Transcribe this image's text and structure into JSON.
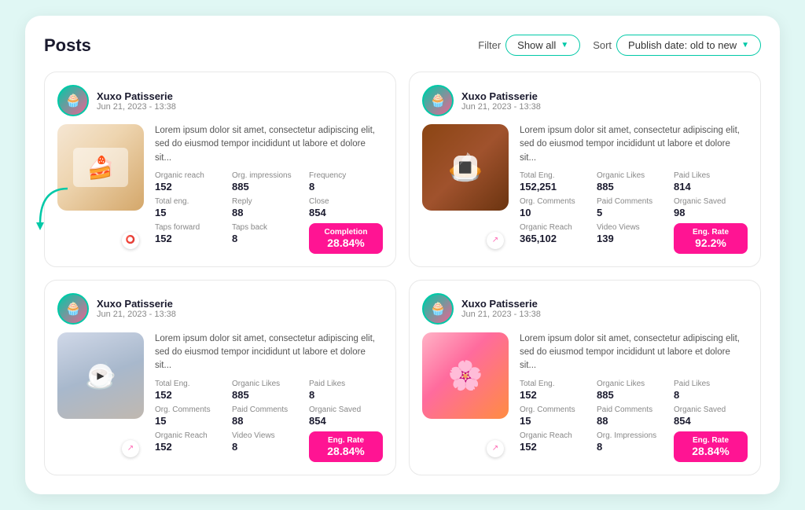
{
  "header": {
    "title": "Posts",
    "filter_label": "Filter",
    "filter_value": "Show all",
    "sort_label": "Sort",
    "sort_value": "Publish date: old to new"
  },
  "posts": [
    {
      "id": "post-1",
      "author": "Xuxo Patisserie",
      "date": "Jun 21, 2023 - 13:38",
      "description": "Lorem ipsum dolor sit amet, consectetur adipiscing elit, sed do eiusmod tempor incididunt ut labore et dolore sit...",
      "image_type": "cake",
      "image_icon": "story",
      "stats": [
        {
          "label": "Organic reach",
          "value": "152"
        },
        {
          "label": "Org. impressions",
          "value": "885"
        },
        {
          "label": "Frequency",
          "value": "8"
        },
        {
          "label": "Total eng.",
          "value": "15"
        },
        {
          "label": "Reply",
          "value": "88"
        },
        {
          "label": "Close",
          "value": "854"
        },
        {
          "label": "Taps forward",
          "value": "152"
        },
        {
          "label": "Taps back",
          "value": "8"
        }
      ],
      "highlight_label": "Completion",
      "highlight_value": "28.84%",
      "has_arrow": true
    },
    {
      "id": "post-2",
      "author": "Xuxo Patisserie",
      "date": "Jun 21, 2023 - 13:38",
      "description": "Lorem ipsum dolor sit amet, consectetur adipiscing elit, sed do eiusmod tempor incididunt ut labore et dolore sit...",
      "image_type": "pie",
      "image_icon": "reel",
      "stats": [
        {
          "label": "Total Eng.",
          "value": "152,251"
        },
        {
          "label": "Organic Likes",
          "value": "885"
        },
        {
          "label": "Paid Likes",
          "value": "814"
        },
        {
          "label": "Org. Comments",
          "value": "10"
        },
        {
          "label": "Paid Comments",
          "value": "5"
        },
        {
          "label": "Organic Saved",
          "value": "98"
        },
        {
          "label": "Organic Reach",
          "value": "365,102"
        },
        {
          "label": "Video Views",
          "value": "139"
        }
      ],
      "highlight_label": "Eng. Rate",
      "highlight_value": "92.2%",
      "has_arrow": false
    },
    {
      "id": "post-3",
      "author": "Xuxo Patisserie",
      "date": "Jun 21, 2023 - 13:38",
      "description": "Lorem ipsum dolor sit amet, consectetur adipiscing elit, sed do eiusmod tempor incididunt ut labore et dolore sit...",
      "image_type": "drink",
      "image_icon": "share",
      "stats": [
        {
          "label": "Total Eng.",
          "value": "152"
        },
        {
          "label": "Organic Likes",
          "value": "885"
        },
        {
          "label": "Paid Likes",
          "value": "8"
        },
        {
          "label": "Org. Comments",
          "value": "15"
        },
        {
          "label": "Paid Comments",
          "value": "88"
        },
        {
          "label": "Organic Saved",
          "value": "854"
        },
        {
          "label": "Organic Reach",
          "value": "152"
        },
        {
          "label": "Video Views",
          "value": "8"
        }
      ],
      "highlight_label": "Eng. Rate",
      "highlight_value": "28.84%",
      "has_arrow": false
    },
    {
      "id": "post-4",
      "author": "Xuxo Patisserie",
      "date": "Jun 21, 2023 - 13:38",
      "description": "Lorem ipsum dolor sit amet, consectetur adipiscing elit, sed do eiusmod tempor incididunt ut labore et dolore sit...",
      "image_type": "floral",
      "image_icon": "share",
      "stats": [
        {
          "label": "Total Eng.",
          "value": "152"
        },
        {
          "label": "Organic Likes",
          "value": "885"
        },
        {
          "label": "Paid Likes",
          "value": "8"
        },
        {
          "label": "Org. Comments",
          "value": "15"
        },
        {
          "label": "Paid Comments",
          "value": "88"
        },
        {
          "label": "Organic Saved",
          "value": "854"
        },
        {
          "label": "Organic Reach",
          "value": "152"
        },
        {
          "label": "Org. Impressions",
          "value": "8"
        }
      ],
      "highlight_label": "Eng. Rate",
      "highlight_value": "28.84%",
      "has_arrow": false
    }
  ]
}
